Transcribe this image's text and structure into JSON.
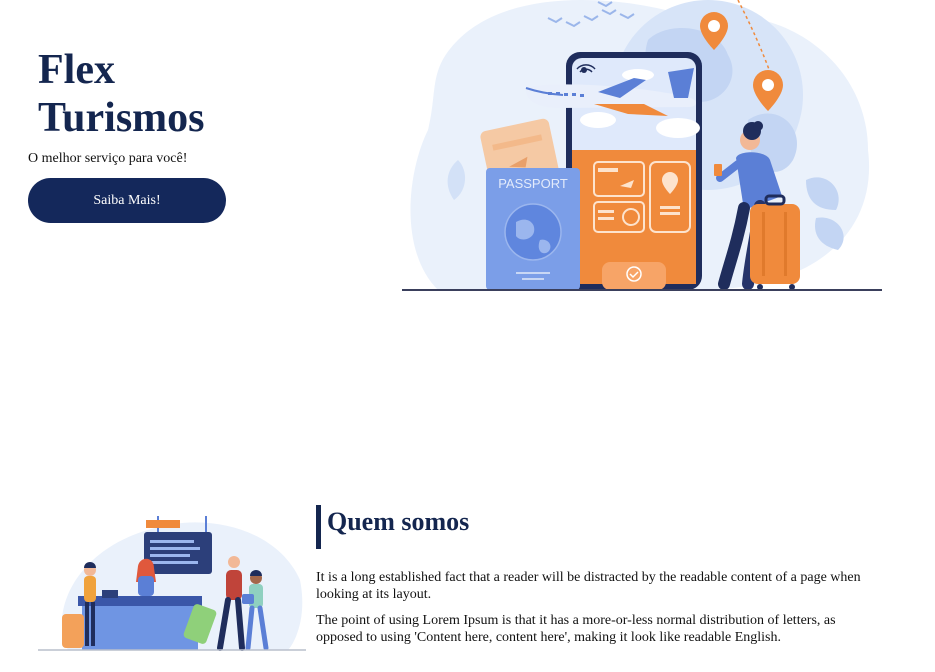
{
  "hero": {
    "title": "Flex Turismos",
    "tagline": "O melhor serviço para você!",
    "cta_label": "Saiba Mais!",
    "passport_text": "PASSPORT"
  },
  "about": {
    "heading": "Quem somos",
    "paragraphs": [
      "It is a long established fact that a reader will be distracted by the readable content of a page when looking at its layout.",
      "The point of using Lorem Ipsum is that it has a more-or-less normal distribution of letters, as opposed to using 'Content here, content here', making it look like readable English."
    ]
  },
  "colors": {
    "brand_navy": "#14264f",
    "accent_orange": "#f08a3c",
    "light_blue": "#e8f0fb",
    "mid_blue": "#7b9ee8"
  }
}
